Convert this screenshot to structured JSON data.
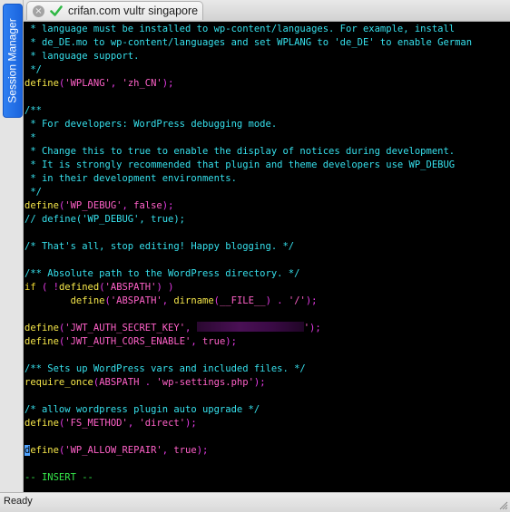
{
  "session_manager": {
    "label": "Session Manager"
  },
  "tab": {
    "title": "crifan.com vultr singapore",
    "close_glyph": "×"
  },
  "status": {
    "text": "Ready"
  },
  "colors": {
    "comment": "#36e0ec",
    "function": "#f5e64a",
    "string": "#ff61c8",
    "punctuation": "#e83be8",
    "keyword": "#eed830",
    "mode": "#35e64a",
    "background": "#000000",
    "cursor": "#4fa3ff"
  },
  "editor": {
    "mode_label": "-- INSERT --",
    "lines": [
      [
        {
          "t": " * language must be installed to wp-content/languages. For example, install",
          "c": "comment"
        }
      ],
      [
        {
          "t": " * de_DE.mo to wp-content/languages and set WPLANG to 'de_DE' to enable German",
          "c": "comment"
        }
      ],
      [
        {
          "t": " * language support.",
          "c": "comment"
        }
      ],
      [
        {
          "t": " */",
          "c": "comment"
        }
      ],
      [
        {
          "t": "define",
          "c": "func"
        },
        {
          "t": "(",
          "c": "punct"
        },
        {
          "t": "'WPLANG'",
          "c": "str"
        },
        {
          "t": ", ",
          "c": "punct"
        },
        {
          "t": "'zh_CN'",
          "c": "str"
        },
        {
          "t": ");",
          "c": "punct"
        }
      ],
      [],
      [
        {
          "t": "/**",
          "c": "comment"
        }
      ],
      [
        {
          "t": " * For developers: WordPress debugging mode.",
          "c": "comment"
        }
      ],
      [
        {
          "t": " *",
          "c": "comment"
        }
      ],
      [
        {
          "t": " * Change this to true to enable the display of notices during development.",
          "c": "comment"
        }
      ],
      [
        {
          "t": " * It is strongly recommended that plugin and theme developers use WP_DEBUG",
          "c": "comment"
        }
      ],
      [
        {
          "t": " * in their development environments.",
          "c": "comment"
        }
      ],
      [
        {
          "t": " */",
          "c": "comment"
        }
      ],
      [
        {
          "t": "define",
          "c": "func"
        },
        {
          "t": "(",
          "c": "punct"
        },
        {
          "t": "'WP_DEBUG'",
          "c": "str"
        },
        {
          "t": ", ",
          "c": "punct"
        },
        {
          "t": "false",
          "c": "const"
        },
        {
          "t": ");",
          "c": "punct"
        }
      ],
      [
        {
          "t": "// define('WP_DEBUG', true);",
          "c": "comment"
        }
      ],
      [],
      [
        {
          "t": "/* That's all, stop editing! Happy blogging. */",
          "c": "comment"
        }
      ],
      [],
      [
        {
          "t": "/** Absolute path to the WordPress directory. */",
          "c": "comment"
        }
      ],
      [
        {
          "t": "if",
          "c": "kw"
        },
        {
          "t": " ( ",
          "c": "punct"
        },
        {
          "t": "!",
          "c": "punct"
        },
        {
          "t": "defined",
          "c": "func"
        },
        {
          "t": "(",
          "c": "punct"
        },
        {
          "t": "'ABSPATH'",
          "c": "str"
        },
        {
          "t": ") )",
          "c": "punct"
        }
      ],
      [
        {
          "t": "        "
        },
        {
          "t": "define",
          "c": "func"
        },
        {
          "t": "(",
          "c": "punct"
        },
        {
          "t": "'ABSPATH'",
          "c": "str"
        },
        {
          "t": ", ",
          "c": "punct"
        },
        {
          "t": "dirname",
          "c": "func"
        },
        {
          "t": "(",
          "c": "punct"
        },
        {
          "t": "__FILE__",
          "c": "const"
        },
        {
          "t": ") . ",
          "c": "punct"
        },
        {
          "t": "'/'",
          "c": "str"
        },
        {
          "t": ");",
          "c": "punct"
        }
      ],
      [],
      [
        {
          "t": "define",
          "c": "func"
        },
        {
          "t": "(",
          "c": "punct"
        },
        {
          "t": "'JWT_AUTH_SECRET_KEY'",
          "c": "str"
        },
        {
          "t": ", ",
          "c": "punct"
        },
        {
          "t": "",
          "c": "redact"
        },
        {
          "t": "'",
          "c": "str"
        },
        {
          "t": ");",
          "c": "punct"
        }
      ],
      [
        {
          "t": "define",
          "c": "func"
        },
        {
          "t": "(",
          "c": "punct"
        },
        {
          "t": "'JWT_AUTH_CORS_ENABLE'",
          "c": "str"
        },
        {
          "t": ", ",
          "c": "punct"
        },
        {
          "t": "true",
          "c": "const"
        },
        {
          "t": ");",
          "c": "punct"
        }
      ],
      [],
      [
        {
          "t": "/** Sets up WordPress vars and included files. */",
          "c": "comment"
        }
      ],
      [
        {
          "t": "require_once",
          "c": "func"
        },
        {
          "t": "(",
          "c": "punct"
        },
        {
          "t": "ABSPATH",
          "c": "const"
        },
        {
          "t": " . ",
          "c": "punct"
        },
        {
          "t": "'wp-settings.php'",
          "c": "str"
        },
        {
          "t": ");",
          "c": "punct"
        }
      ],
      [],
      [
        {
          "t": "/* allow wordpress plugin auto upgrade */",
          "c": "comment"
        }
      ],
      [
        {
          "t": "define",
          "c": "func"
        },
        {
          "t": "(",
          "c": "punct"
        },
        {
          "t": "'FS_METHOD'",
          "c": "str"
        },
        {
          "t": ", ",
          "c": "punct"
        },
        {
          "t": "'direct'",
          "c": "str"
        },
        {
          "t": ");",
          "c": "punct"
        }
      ],
      [],
      [
        {
          "t": "d",
          "c": "cursor"
        },
        {
          "t": "efine",
          "c": "func"
        },
        {
          "t": "(",
          "c": "punct"
        },
        {
          "t": "'WP_ALLOW_REPAIR'",
          "c": "str"
        },
        {
          "t": ", ",
          "c": "punct"
        },
        {
          "t": "true",
          "c": "const"
        },
        {
          "t": ");",
          "c": "punct"
        }
      ],
      []
    ]
  }
}
